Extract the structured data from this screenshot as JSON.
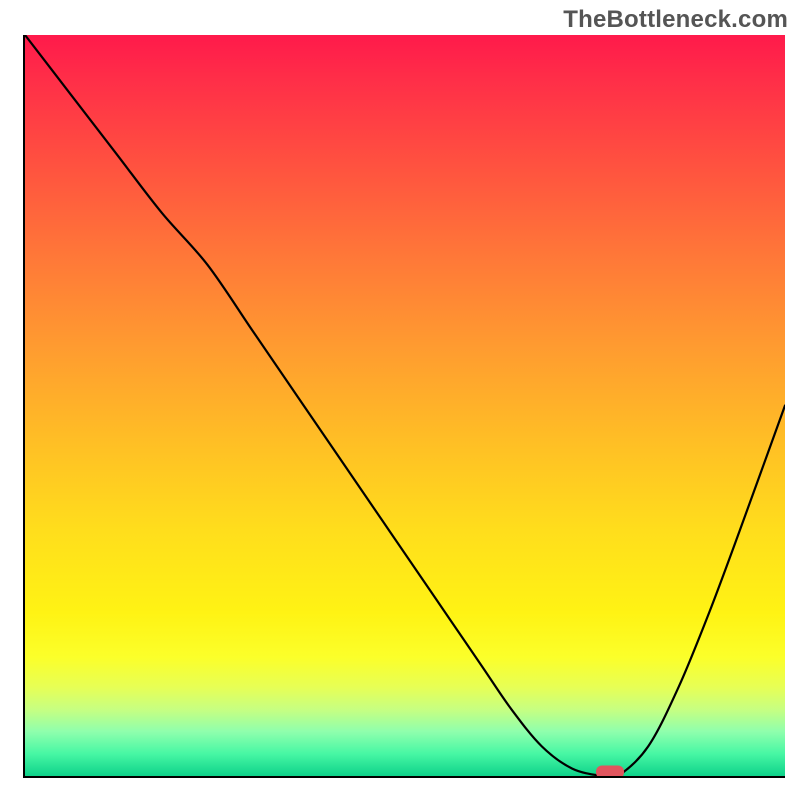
{
  "watermark": "TheBottleneck.com",
  "chart_data": {
    "type": "line",
    "title": "",
    "xlabel": "",
    "ylabel": "",
    "xlim": [
      0,
      100
    ],
    "ylim": [
      0,
      100
    ],
    "grid": false,
    "legend": false,
    "background": "rainbow-gradient-vertical",
    "series": [
      {
        "name": "bottleneck-curve",
        "x": [
          0,
          6,
          12,
          18,
          24,
          30,
          36,
          42,
          48,
          54,
          60,
          64,
          68,
          72,
          76,
          78,
          82,
          86,
          90,
          94,
          100
        ],
        "values": [
          100,
          92,
          84,
          76,
          69,
          60,
          51,
          42,
          33,
          24,
          15,
          9,
          4,
          1,
          0,
          0,
          4,
          12,
          22,
          33,
          50
        ]
      }
    ],
    "marker": {
      "x": 77,
      "y": 0,
      "shape": "rounded-rect",
      "color": "#e0555e"
    },
    "colors": {
      "top": "#ff1a4b",
      "mid": "#ffd323",
      "bottom": "#0ed28a",
      "curve": "#000000"
    }
  }
}
